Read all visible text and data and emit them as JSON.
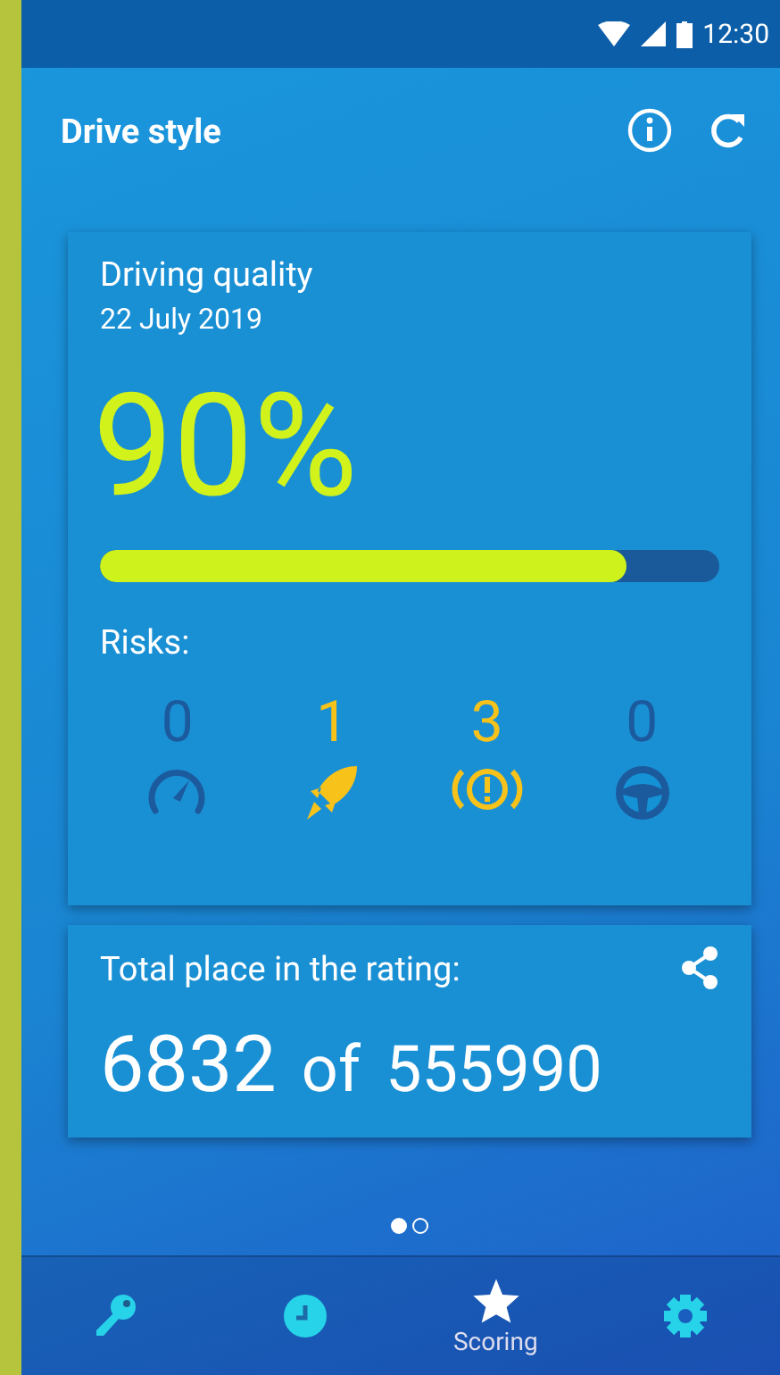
{
  "status_bar": {
    "time": "12:30"
  },
  "app_bar": {
    "title": "Drive style"
  },
  "quality_card": {
    "title": "Driving quality",
    "date": "22 July 2019",
    "percent": "90%",
    "level": 0.85,
    "risks_label": "Risks:",
    "risks": [
      {
        "kind": "speed",
        "count": "0",
        "active": false
      },
      {
        "kind": "acceleration",
        "count": "1",
        "active": true
      },
      {
        "kind": "braking",
        "count": "3",
        "active": true
      },
      {
        "kind": "steering",
        "count": "0",
        "active": false
      }
    ]
  },
  "rating_card": {
    "title": "Total place in the rating:",
    "place": "6832",
    "of": "of",
    "total": "555990"
  },
  "pager": [
    {
      "selected": true
    },
    {
      "selected": false
    }
  ],
  "bottom_nav": [
    {
      "kind": "key",
      "selected": false
    },
    {
      "kind": "clock",
      "selected": false
    },
    {
      "kind": "star",
      "label": "Scoring",
      "selected": true
    },
    {
      "kind": "gear",
      "selected": false
    }
  ]
}
